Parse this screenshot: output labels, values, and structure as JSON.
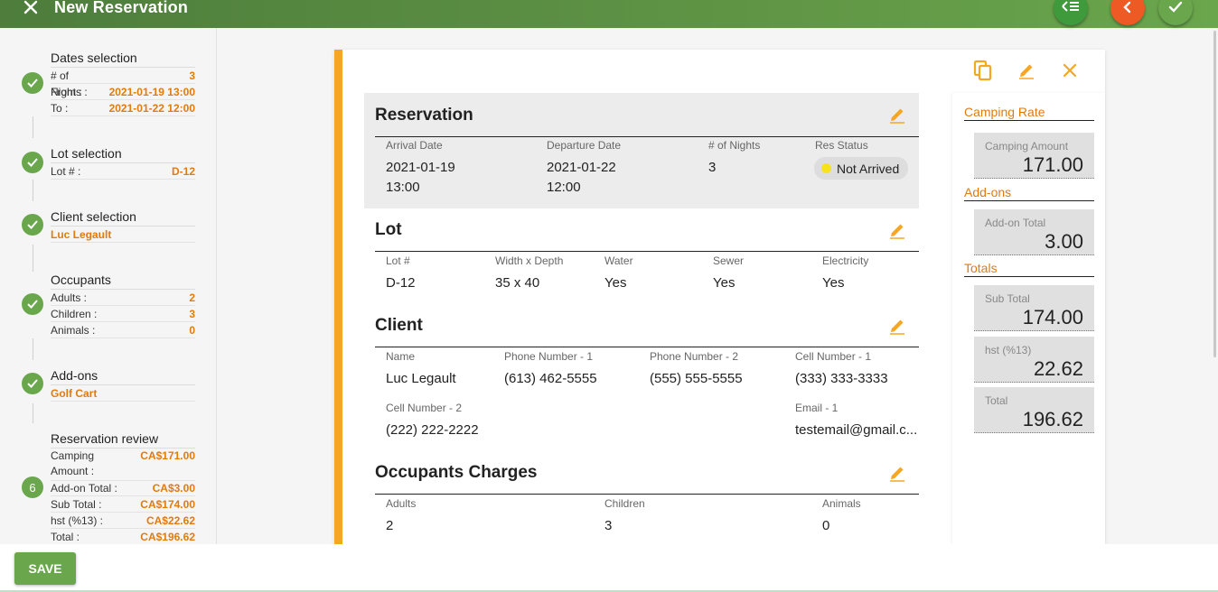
{
  "header": {
    "title": "New Reservation"
  },
  "sidebar": {
    "steps": [
      {
        "title": "Dates selection",
        "rows": [
          {
            "k": "# of Nights :",
            "v": "3"
          },
          {
            "k": "From :",
            "v": "2021-01-19 13:00"
          },
          {
            "k": "To :",
            "v": "2021-01-22 12:00"
          }
        ]
      },
      {
        "title": "Lot selection",
        "rows": [
          {
            "k": "Lot # :",
            "v": "D-12"
          }
        ]
      },
      {
        "title": "Client selection",
        "value": "Luc Legault"
      },
      {
        "title": "Occupants",
        "rows": [
          {
            "k": "Adults :",
            "v": "2"
          },
          {
            "k": "Children :",
            "v": "3"
          },
          {
            "k": "Animals :",
            "v": "0"
          }
        ]
      },
      {
        "title": "Add-ons",
        "value": "Golf Cart"
      },
      {
        "title": "Reservation review",
        "number": "6",
        "rows": [
          {
            "k": "Camping",
            "k2": "Amount :",
            "v": "CA$171.00"
          },
          {
            "k": "Add-on Total :",
            "v": "CA$3.00"
          },
          {
            "k": "Sub Total :",
            "v": "CA$174.00"
          },
          {
            "k": "hst (%13) :",
            "v": "CA$22.62"
          },
          {
            "k": "Total :",
            "v": "CA$196.62"
          }
        ]
      }
    ]
  },
  "reservation": {
    "title": "Reservation",
    "labels": {
      "arrival": "Arrival Date",
      "departure": "Departure Date",
      "nights": "# of Nights",
      "status": "Res Status"
    },
    "values": {
      "arrival_date": "2021-01-19",
      "arrival_time": "13:00",
      "departure_date": "2021-01-22",
      "departure_time": "12:00",
      "nights": "3",
      "status": "Not Arrived"
    }
  },
  "lot": {
    "title": "Lot",
    "labels": {
      "lot": "Lot #",
      "size": "Width x Depth",
      "water": "Water",
      "sewer": "Sewer",
      "electricity": "Electricity"
    },
    "values": {
      "lot": "D-12",
      "size": "35 x 40",
      "water": "Yes",
      "sewer": "Yes",
      "electricity": "Yes"
    }
  },
  "client": {
    "title": "Client",
    "labels": {
      "name": "Name",
      "phone1": "Phone Number - 1",
      "phone2": "Phone Number - 2",
      "cell1": "Cell Number - 1",
      "cell2": "Cell Number - 2",
      "email1": "Email - 1"
    },
    "values": {
      "name": "Luc Legault",
      "phone1": "(613) 462-5555",
      "phone2": "(555) 555-5555",
      "cell1": "(333) 333-3333",
      "cell2": "(222) 222-2222",
      "email1": "testemail@gmail.c..."
    }
  },
  "occupants": {
    "title": "Occupants Charges",
    "labels": {
      "adults": "Adults",
      "children": "Children",
      "animals": "Animals"
    },
    "values": {
      "adults": "2",
      "children": "3",
      "animals": "0"
    }
  },
  "summary": {
    "camping_rate": "Camping Rate",
    "camping_amount_label": "Camping Amount",
    "camping_amount": "171.00",
    "addons": "Add-ons",
    "addon_total_label": "Add-on Total",
    "addon_total": "3.00",
    "totals": "Totals",
    "subtotal_label": "Sub Total",
    "subtotal": "174.00",
    "hst_label": "hst (%13)",
    "hst": "22.62",
    "total_label": "Total",
    "total": "196.62"
  },
  "footer": {
    "save_label": "SAVE"
  },
  "colors": {
    "accent": "#f5a623",
    "green": "#6aa64c",
    "orange_text": "#e07b10",
    "back_button": "#ee5a24"
  }
}
